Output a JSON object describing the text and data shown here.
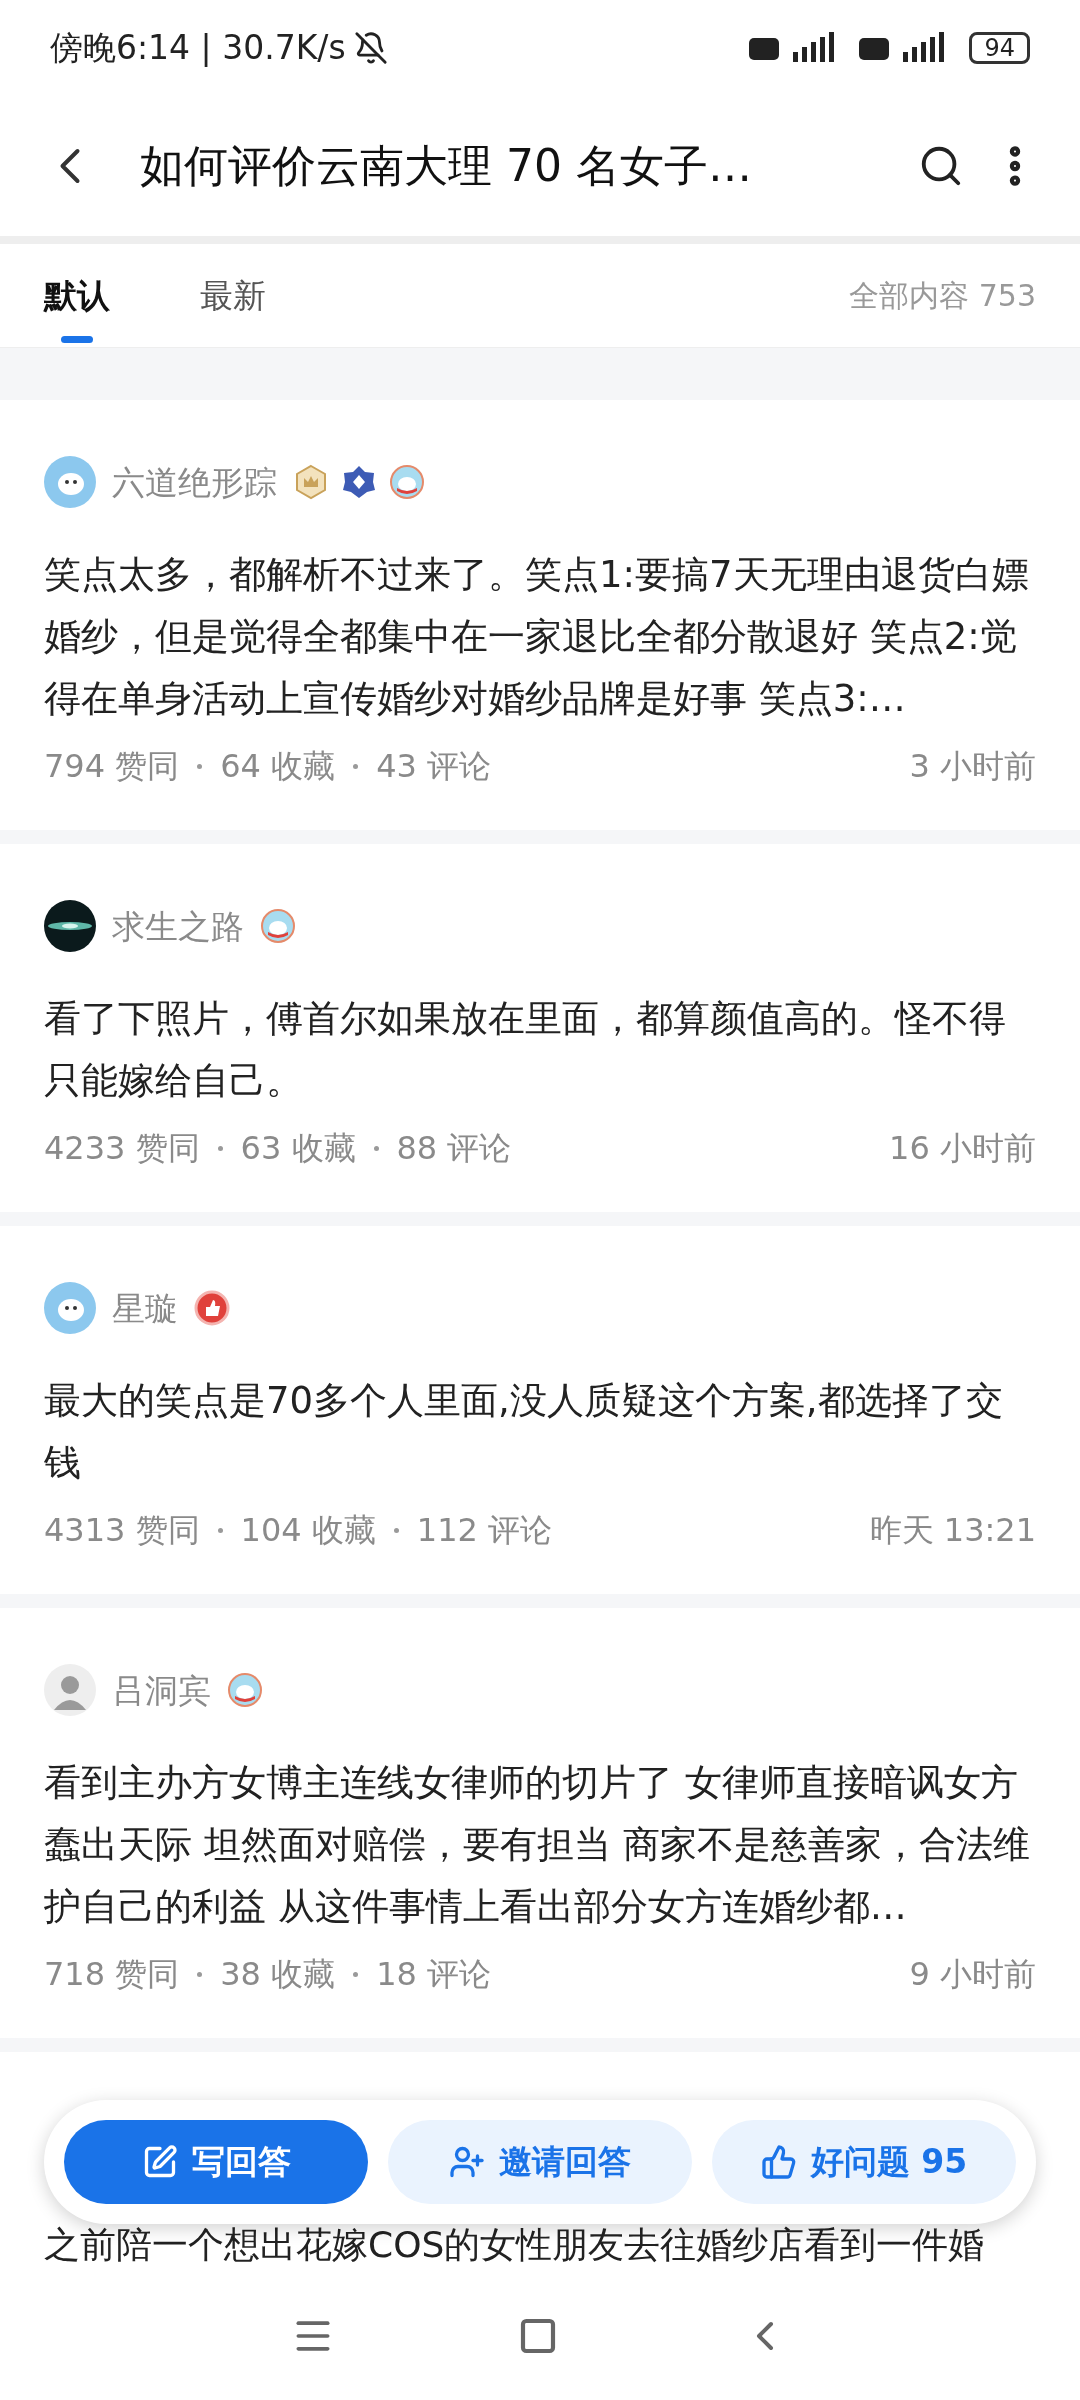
{
  "status_bar": {
    "time": "傍晚6:14 | 30.7K/s",
    "battery": "94"
  },
  "header": {
    "title": "如何评价云南大理 70 名女子…"
  },
  "tabs": [
    {
      "label": "默认",
      "selected": true
    },
    {
      "label": "最新",
      "selected": false
    }
  ],
  "total": "全部内容 753",
  "answers": [
    {
      "author": "六道绝形踪",
      "avatar": {
        "kind": "dog"
      },
      "badges": [
        {
          "kind": "crown"
        },
        {
          "kind": "diamond"
        },
        {
          "kind": "mascot"
        }
      ],
      "text": "笑点太多，都解析不过来了。笑点1:要搞7天无理由退货白嫖婚纱，但是觉得全都集中在一家退比全都分散退好 笑点2:觉得在单身活动上宣传婚纱对婚纱品牌是好事 笑点3:…",
      "stats": [
        "794 赞同",
        "64 收藏",
        "43 评论"
      ],
      "time": "3 小时前"
    },
    {
      "author": "求生之路",
      "avatar": {
        "kind": "galaxy"
      },
      "badges": [
        {
          "kind": "mascot"
        }
      ],
      "text": "看了下照片，傅首尔如果放在里面，都算颜值高的。怪不得只能嫁给自己。",
      "stats": [
        "4233 赞同",
        "63 收藏",
        "88 评论"
      ],
      "time": "16 小时前"
    },
    {
      "author": "星璇",
      "avatar": {
        "kind": "dog"
      },
      "badges": [
        {
          "kind": "like"
        }
      ],
      "text": "最大的笑点是70多个人里面,没人质疑这个方案,都选择了交钱",
      "stats": [
        "4313 赞同",
        "104 收藏",
        "112 评论"
      ],
      "time": "昨天 13:21"
    },
    {
      "author": "吕洞宾",
      "avatar": {
        "kind": "person"
      },
      "badges": [
        {
          "kind": "mascot"
        }
      ],
      "text": "看到主办方女博主连线女律师的切片了 女律师直接暗讽女方蠢出天际 坦然面对赔偿，要有担当 商家不是慈善家，合法维护自己的利益 从这件事情上看出部分女方连婚纱都…",
      "stats": [
        "718 赞同",
        "38 收藏",
        "18 评论"
      ],
      "time": "9 小时前"
    }
  ],
  "partial_answer": {
    "text": "之前陪一个想出花嫁COS的女性朋友去往婚纱店看到一件婚"
  },
  "actions": [
    {
      "label": "写回答",
      "kind": "write"
    },
    {
      "label": "邀请回答",
      "kind": "invite"
    },
    {
      "label": "好问题 95",
      "kind": "like"
    }
  ]
}
